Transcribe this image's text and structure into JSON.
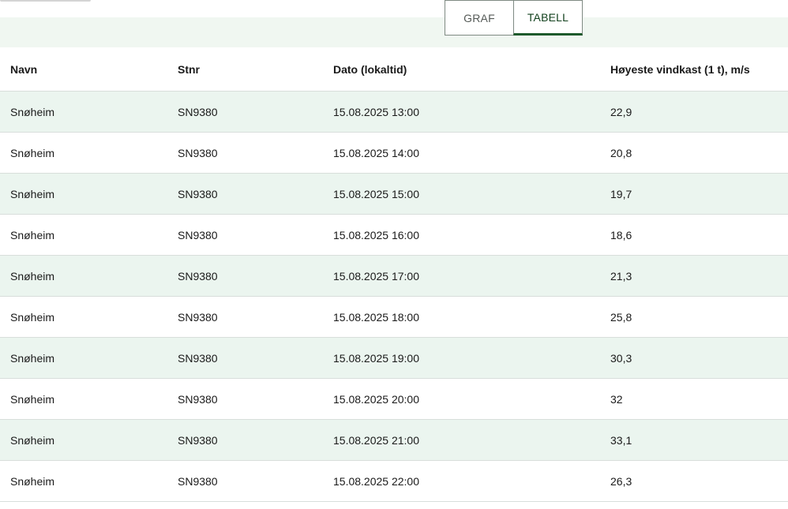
{
  "tabs": {
    "graf_label": "GRAF",
    "tabell_label": "TABELL",
    "active": "TABELL"
  },
  "colors": {
    "accent": "#1e5a2c",
    "row_stripe": "#ebf5ef",
    "band": "#f0f7f1"
  },
  "table": {
    "headers": {
      "navn": "Navn",
      "stnr": "Stnr",
      "dato": "Dato (lokaltid)",
      "vindkast": "Høyeste vindkast (1 t), m/s"
    },
    "rows": [
      {
        "navn": "Snøheim",
        "stnr": "SN9380",
        "dato": "15.08.2025 13:00",
        "vindkast": "22,9"
      },
      {
        "navn": "Snøheim",
        "stnr": "SN9380",
        "dato": "15.08.2025 14:00",
        "vindkast": "20,8"
      },
      {
        "navn": "Snøheim",
        "stnr": "SN9380",
        "dato": "15.08.2025 15:00",
        "vindkast": "19,7"
      },
      {
        "navn": "Snøheim",
        "stnr": "SN9380",
        "dato": "15.08.2025 16:00",
        "vindkast": "18,6"
      },
      {
        "navn": "Snøheim",
        "stnr": "SN9380",
        "dato": "15.08.2025 17:00",
        "vindkast": "21,3"
      },
      {
        "navn": "Snøheim",
        "stnr": "SN9380",
        "dato": "15.08.2025 18:00",
        "vindkast": "25,8"
      },
      {
        "navn": "Snøheim",
        "stnr": "SN9380",
        "dato": "15.08.2025 19:00",
        "vindkast": "30,3"
      },
      {
        "navn": "Snøheim",
        "stnr": "SN9380",
        "dato": "15.08.2025 20:00",
        "vindkast": "32"
      },
      {
        "navn": "Snøheim",
        "stnr": "SN9380",
        "dato": "15.08.2025 21:00",
        "vindkast": "33,1"
      },
      {
        "navn": "Snøheim",
        "stnr": "SN9380",
        "dato": "15.08.2025 22:00",
        "vindkast": "26,3"
      }
    ]
  }
}
